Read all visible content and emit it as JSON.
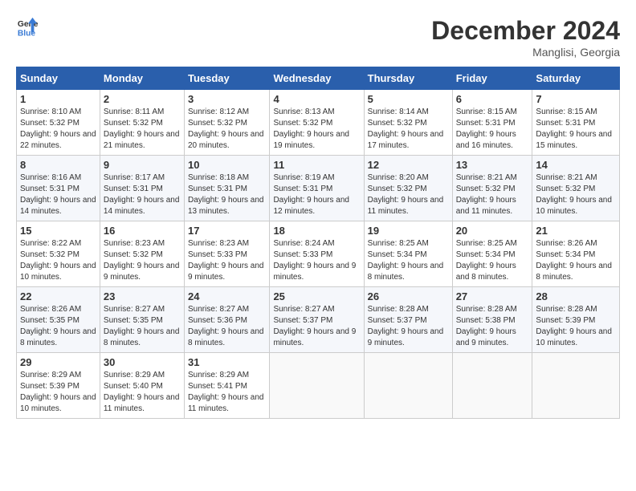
{
  "header": {
    "logo_line1": "General",
    "logo_line2": "Blue",
    "month": "December 2024",
    "location": "Manglisi, Georgia"
  },
  "columns": [
    "Sunday",
    "Monday",
    "Tuesday",
    "Wednesday",
    "Thursday",
    "Friday",
    "Saturday"
  ],
  "weeks": [
    [
      {
        "day": "1",
        "sunrise": "Sunrise: 8:10 AM",
        "sunset": "Sunset: 5:32 PM",
        "daylight": "Daylight: 9 hours and 22 minutes."
      },
      {
        "day": "2",
        "sunrise": "Sunrise: 8:11 AM",
        "sunset": "Sunset: 5:32 PM",
        "daylight": "Daylight: 9 hours and 21 minutes."
      },
      {
        "day": "3",
        "sunrise": "Sunrise: 8:12 AM",
        "sunset": "Sunset: 5:32 PM",
        "daylight": "Daylight: 9 hours and 20 minutes."
      },
      {
        "day": "4",
        "sunrise": "Sunrise: 8:13 AM",
        "sunset": "Sunset: 5:32 PM",
        "daylight": "Daylight: 9 hours and 19 minutes."
      },
      {
        "day": "5",
        "sunrise": "Sunrise: 8:14 AM",
        "sunset": "Sunset: 5:32 PM",
        "daylight": "Daylight: 9 hours and 17 minutes."
      },
      {
        "day": "6",
        "sunrise": "Sunrise: 8:15 AM",
        "sunset": "Sunset: 5:31 PM",
        "daylight": "Daylight: 9 hours and 16 minutes."
      },
      {
        "day": "7",
        "sunrise": "Sunrise: 8:15 AM",
        "sunset": "Sunset: 5:31 PM",
        "daylight": "Daylight: 9 hours and 15 minutes."
      }
    ],
    [
      {
        "day": "8",
        "sunrise": "Sunrise: 8:16 AM",
        "sunset": "Sunset: 5:31 PM",
        "daylight": "Daylight: 9 hours and 14 minutes."
      },
      {
        "day": "9",
        "sunrise": "Sunrise: 8:17 AM",
        "sunset": "Sunset: 5:31 PM",
        "daylight": "Daylight: 9 hours and 14 minutes."
      },
      {
        "day": "10",
        "sunrise": "Sunrise: 8:18 AM",
        "sunset": "Sunset: 5:31 PM",
        "daylight": "Daylight: 9 hours and 13 minutes."
      },
      {
        "day": "11",
        "sunrise": "Sunrise: 8:19 AM",
        "sunset": "Sunset: 5:31 PM",
        "daylight": "Daylight: 9 hours and 12 minutes."
      },
      {
        "day": "12",
        "sunrise": "Sunrise: 8:20 AM",
        "sunset": "Sunset: 5:32 PM",
        "daylight": "Daylight: 9 hours and 11 minutes."
      },
      {
        "day": "13",
        "sunrise": "Sunrise: 8:21 AM",
        "sunset": "Sunset: 5:32 PM",
        "daylight": "Daylight: 9 hours and 11 minutes."
      },
      {
        "day": "14",
        "sunrise": "Sunrise: 8:21 AM",
        "sunset": "Sunset: 5:32 PM",
        "daylight": "Daylight: 9 hours and 10 minutes."
      }
    ],
    [
      {
        "day": "15",
        "sunrise": "Sunrise: 8:22 AM",
        "sunset": "Sunset: 5:32 PM",
        "daylight": "Daylight: 9 hours and 10 minutes."
      },
      {
        "day": "16",
        "sunrise": "Sunrise: 8:23 AM",
        "sunset": "Sunset: 5:32 PM",
        "daylight": "Daylight: 9 hours and 9 minutes."
      },
      {
        "day": "17",
        "sunrise": "Sunrise: 8:23 AM",
        "sunset": "Sunset: 5:33 PM",
        "daylight": "Daylight: 9 hours and 9 minutes."
      },
      {
        "day": "18",
        "sunrise": "Sunrise: 8:24 AM",
        "sunset": "Sunset: 5:33 PM",
        "daylight": "Daylight: 9 hours and 9 minutes."
      },
      {
        "day": "19",
        "sunrise": "Sunrise: 8:25 AM",
        "sunset": "Sunset: 5:34 PM",
        "daylight": "Daylight: 9 hours and 8 minutes."
      },
      {
        "day": "20",
        "sunrise": "Sunrise: 8:25 AM",
        "sunset": "Sunset: 5:34 PM",
        "daylight": "Daylight: 9 hours and 8 minutes."
      },
      {
        "day": "21",
        "sunrise": "Sunrise: 8:26 AM",
        "sunset": "Sunset: 5:34 PM",
        "daylight": "Daylight: 9 hours and 8 minutes."
      }
    ],
    [
      {
        "day": "22",
        "sunrise": "Sunrise: 8:26 AM",
        "sunset": "Sunset: 5:35 PM",
        "daylight": "Daylight: 9 hours and 8 minutes."
      },
      {
        "day": "23",
        "sunrise": "Sunrise: 8:27 AM",
        "sunset": "Sunset: 5:35 PM",
        "daylight": "Daylight: 9 hours and 8 minutes."
      },
      {
        "day": "24",
        "sunrise": "Sunrise: 8:27 AM",
        "sunset": "Sunset: 5:36 PM",
        "daylight": "Daylight: 9 hours and 8 minutes."
      },
      {
        "day": "25",
        "sunrise": "Sunrise: 8:27 AM",
        "sunset": "Sunset: 5:37 PM",
        "daylight": "Daylight: 9 hours and 9 minutes."
      },
      {
        "day": "26",
        "sunrise": "Sunrise: 8:28 AM",
        "sunset": "Sunset: 5:37 PM",
        "daylight": "Daylight: 9 hours and 9 minutes."
      },
      {
        "day": "27",
        "sunrise": "Sunrise: 8:28 AM",
        "sunset": "Sunset: 5:38 PM",
        "daylight": "Daylight: 9 hours and 9 minutes."
      },
      {
        "day": "28",
        "sunrise": "Sunrise: 8:28 AM",
        "sunset": "Sunset: 5:39 PM",
        "daylight": "Daylight: 9 hours and 10 minutes."
      }
    ],
    [
      {
        "day": "29",
        "sunrise": "Sunrise: 8:29 AM",
        "sunset": "Sunset: 5:39 PM",
        "daylight": "Daylight: 9 hours and 10 minutes."
      },
      {
        "day": "30",
        "sunrise": "Sunrise: 8:29 AM",
        "sunset": "Sunset: 5:40 PM",
        "daylight": "Daylight: 9 hours and 11 minutes."
      },
      {
        "day": "31",
        "sunrise": "Sunrise: 8:29 AM",
        "sunset": "Sunset: 5:41 PM",
        "daylight": "Daylight: 9 hours and 11 minutes."
      },
      null,
      null,
      null,
      null
    ]
  ]
}
